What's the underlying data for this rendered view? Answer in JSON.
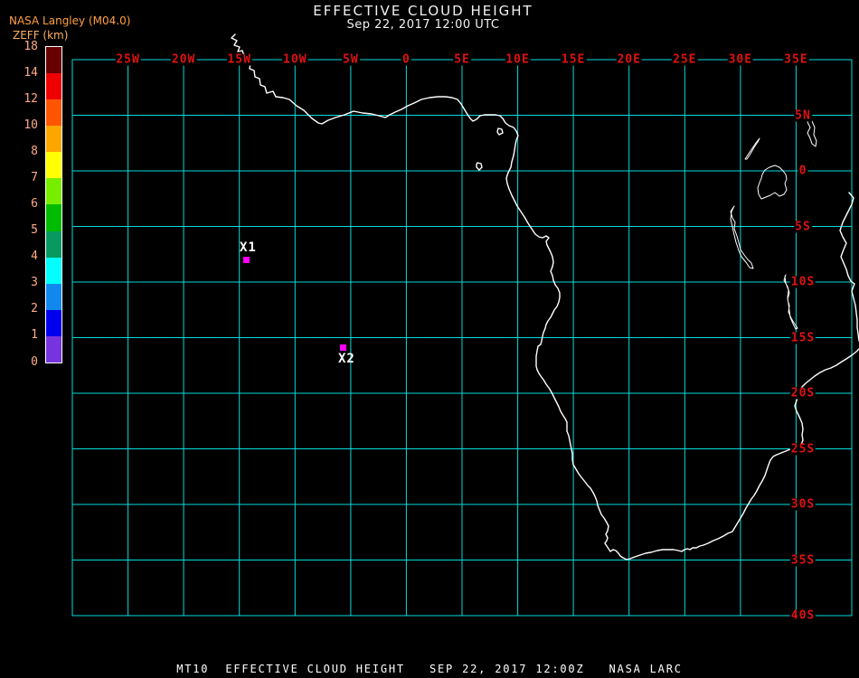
{
  "header": {
    "source": "NASA Langley (M04.0)",
    "unit": "ZEFF (km)",
    "title": "EFFECTIVE CLOUD HEIGHT",
    "subtitle": "Sep 22, 2017 12:00 UTC"
  },
  "legend": {
    "ticks": [
      "18",
      "14",
      "12",
      "10",
      "8",
      "7",
      "6",
      "5",
      "4",
      "3",
      "2",
      "1",
      "0"
    ],
    "segment_colors_top_to_bottom": [
      "#660000",
      "#ee0000",
      "#ff5500",
      "#ffa500",
      "#ffff00",
      "#77ee00",
      "#00bb00",
      "#089960",
      "#00ffff",
      "#1188ee",
      "#0000ee",
      "#7733dd"
    ]
  },
  "map": {
    "lon_labels": [
      "25W",
      "20W",
      "15W",
      "10W",
      "5W",
      "0",
      "5E",
      "10E",
      "15E",
      "20E",
      "25E",
      "30E",
      "35E"
    ],
    "lat_labels": [
      "5N",
      "0",
      "5S",
      "10S",
      "15S",
      "20S",
      "25S",
      "30S",
      "35S",
      "40S"
    ],
    "markers": [
      {
        "label": "X1"
      },
      {
        "label": "X2"
      }
    ],
    "grid_color": "#00dcdc",
    "coast_color": "#ffffff",
    "grid_label_color": "#e01212",
    "marker_color": "#ff00ff"
  },
  "footer": {
    "text": "MT10  EFFECTIVE CLOUD HEIGHT   SEP 22, 2017 12:00Z   NASA LARC"
  }
}
